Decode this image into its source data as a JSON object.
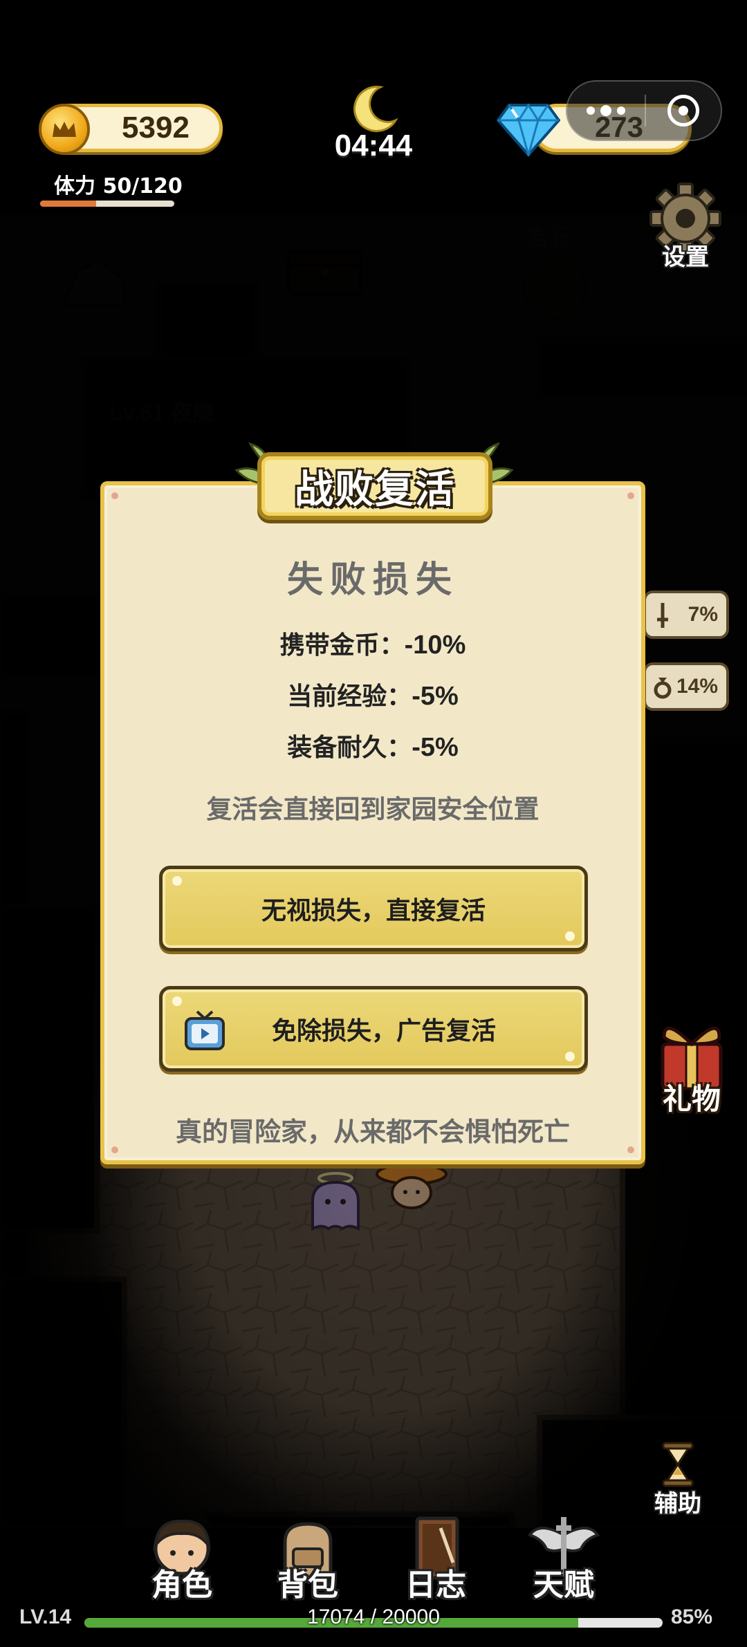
{
  "hud": {
    "coins": "5392",
    "stamina_label": "体力 50/120",
    "stamina_fraction": 0.4167,
    "clock": "04:44",
    "gems": "273",
    "settings_label": "设置"
  },
  "map": {
    "rock_label": "岩石",
    "monster_label": "Lv.61 夜魔"
  },
  "side_stats": [
    {
      "icon": "sword-icon",
      "value": "7%"
    },
    {
      "icon": "shield-icon",
      "value": "14%"
    }
  ],
  "gift_label": "礼物",
  "assist_label": "辅助",
  "modal": {
    "title": "战败复活",
    "loss_title": "失败损失",
    "losses": [
      {
        "label": "携带金币：",
        "value": "-10%"
      },
      {
        "label": "当前经验：",
        "value": "-5%"
      },
      {
        "label": "装备耐久：",
        "value": "-5%"
      }
    ],
    "notice": "复活会直接回到家园安全位置",
    "btn_revive": "无视损失，直接复活",
    "btn_ad_revive": "免除损失，广告复活",
    "motto": "真的冒险家，从来都不会惧怕死亡"
  },
  "nav": {
    "items": [
      {
        "label": "角色",
        "icon": "character-icon"
      },
      {
        "label": "背包",
        "icon": "backpack-icon"
      },
      {
        "label": "日志",
        "icon": "journal-icon"
      },
      {
        "label": "天赋",
        "icon": "talent-icon"
      }
    ]
  },
  "level": {
    "label": "LV.14",
    "xp_text": "17074 / 20000",
    "xp_fraction": 0.8537,
    "percent": "85%"
  },
  "colors": {
    "panel_bg": "#f2e8c8",
    "panel_border": "#e9c24a",
    "button_fill": "#e3c95c",
    "xp_bar": "#56a83a",
    "stamina_bar": "#e07a3a"
  }
}
